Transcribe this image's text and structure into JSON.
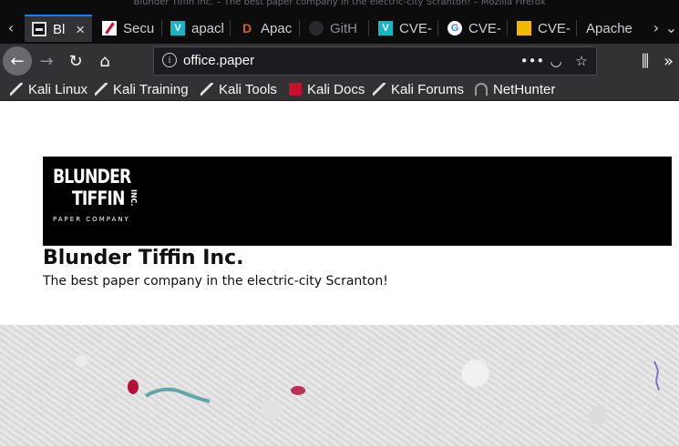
{
  "window": {
    "title": "Blunder Tiffin Inc. – The best paper company in the electric-city Scranton! – Mozilla Firefox"
  },
  "tabs": [
    {
      "label": "Bl",
      "favicon": "blunder-tiffin-favicon",
      "active": true
    },
    {
      "label": "Secu",
      "favicon": "security-favicon"
    },
    {
      "label": "apacl",
      "favicon": "vulners-favicon",
      "color": "#1ab5c5"
    },
    {
      "label": "Apac",
      "favicon": "dev-favicon",
      "color": "#e05a1c"
    },
    {
      "label": "GitH",
      "favicon": "github-favicon"
    },
    {
      "label": "CVE-",
      "favicon": "vulners-favicon",
      "color": "#1ab5c5"
    },
    {
      "label": "CVE-",
      "favicon": "google-favicon"
    },
    {
      "label": "CVE-",
      "favicon": "exploit-favicon",
      "color": "#f5b800"
    },
    {
      "label": "Apache",
      "favicon": ""
    }
  ],
  "nav": {
    "url": "office.paper",
    "icons": [
      "back-icon",
      "forward-icon",
      "reload-icon",
      "home-icon",
      "page-actions-icon",
      "pocket-icon",
      "bookmark-star-icon",
      "library-icon",
      "overflow-icon"
    ]
  },
  "bookmarks": [
    {
      "label": "Kali Linux"
    },
    {
      "label": "Kali Training"
    },
    {
      "label": "Kali Tools"
    },
    {
      "label": "Kali Docs"
    },
    {
      "label": "Kali Forums"
    },
    {
      "label": "NetHunter"
    }
  ],
  "page": {
    "logo": {
      "line1": "BLUNDER",
      "line2": "TIFFIN",
      "inc": "INC.",
      "sub": "PAPER COMPANY"
    },
    "title": "Blunder Tiffin Inc.",
    "tagline": "The best paper company in the electric-city Scranton!"
  },
  "colors": {
    "chrome": "#0c0c0d",
    "toolbar": "#323234",
    "accent": "#0a84ff",
    "banner": "#000000"
  }
}
